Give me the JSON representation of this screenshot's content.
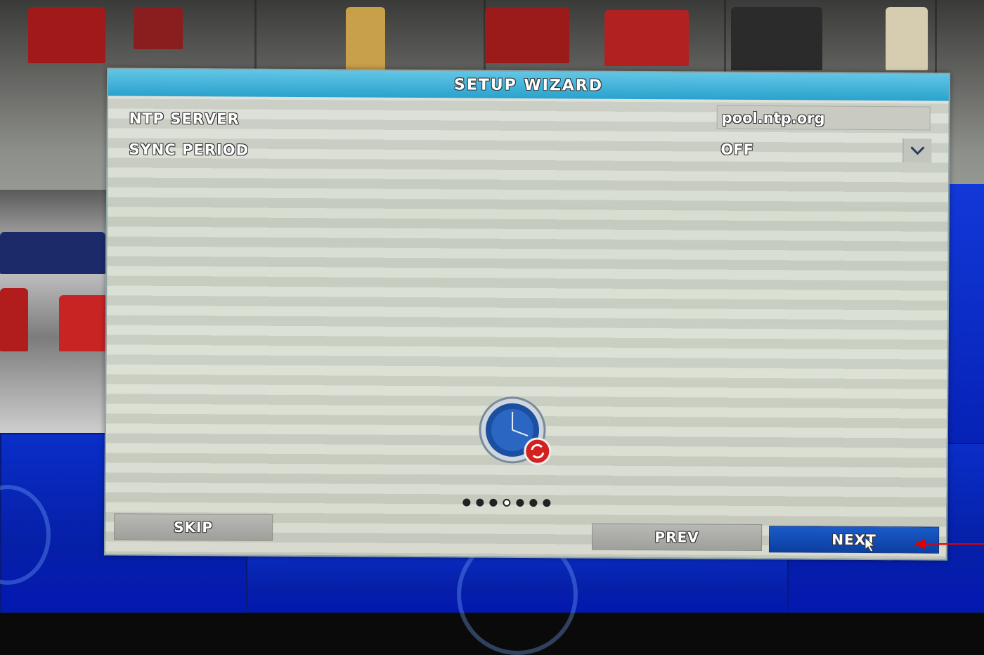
{
  "dialog": {
    "title": "SETUP WIZARD",
    "ntp_server": {
      "label": "NTP SERVER",
      "value": "pool.ntp.org"
    },
    "sync_period": {
      "label": "SYNC PERIOD",
      "value": "OFF"
    },
    "icon": "clock-sync-icon",
    "progress": {
      "total_steps": 7,
      "current_step": 4
    },
    "buttons": {
      "skip": "SKIP",
      "prev": "PREV",
      "next": "NEXT"
    }
  },
  "colors": {
    "title_bar": "#2aa2cd",
    "next_button": "#0c3ea0",
    "annotation_arrow": "#e00000"
  }
}
